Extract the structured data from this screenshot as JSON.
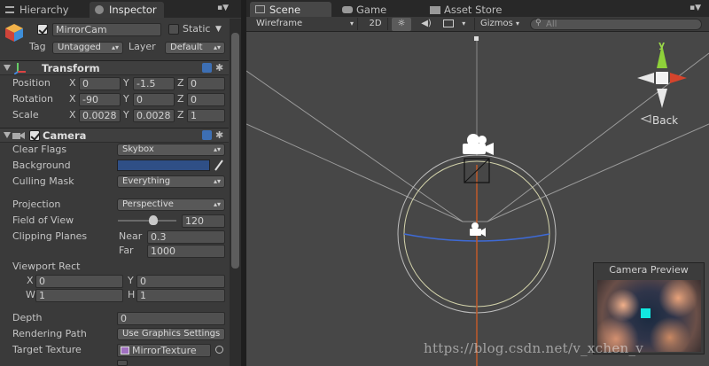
{
  "tabs": {
    "hierarchy": "Hierarchy",
    "inspector": "Inspector",
    "scene": "Scene",
    "game": "Game",
    "asset_store": "Asset Store"
  },
  "object": {
    "name": "MirrorCam",
    "static_label": "Static",
    "tag_label": "Tag",
    "tag_value": "Untagged",
    "layer_label": "Layer",
    "layer_value": "Default",
    "active": true,
    "static": false
  },
  "transform": {
    "title": "Transform",
    "position": {
      "label": "Position",
      "x": "0",
      "y": "-1.5",
      "z": "0"
    },
    "rotation": {
      "label": "Rotation",
      "x": "-90",
      "y": "0",
      "z": "0"
    },
    "scale": {
      "label": "Scale",
      "x": "0.0028",
      "y": "0.0028",
      "z": "1"
    }
  },
  "camera": {
    "title": "Camera",
    "clear_flags": {
      "label": "Clear Flags",
      "value": "Skybox"
    },
    "background": {
      "label": "Background",
      "color": "#2f4f86"
    },
    "culling_mask": {
      "label": "Culling Mask",
      "value": "Everything"
    },
    "projection": {
      "label": "Projection",
      "value": "Perspective"
    },
    "fov": {
      "label": "Field of View",
      "value": "120",
      "slider_fraction": 0.6
    },
    "clipping": {
      "label": "Clipping Planes",
      "near_label": "Near",
      "near": "0.3",
      "far_label": "Far",
      "far": "1000"
    },
    "viewport": {
      "label": "Viewport Rect",
      "x": "0",
      "y": "0",
      "w": "1",
      "h": "1"
    },
    "depth": {
      "label": "Depth",
      "value": "0"
    },
    "rendering_path": {
      "label": "Rendering Path",
      "value": "Use Graphics Settings"
    },
    "target_texture": {
      "label": "Target Texture",
      "value": "MirrorTexture"
    }
  },
  "axis": {
    "x": "X",
    "y": "Y",
    "z": "Z",
    "w": "W",
    "h": "H"
  },
  "scene_toolbar": {
    "shading": "Wireframe",
    "mode_2d": "2D",
    "gizmos": "Gizmos",
    "search_placeholder": "All"
  },
  "gizmo": {
    "back_label": "Back",
    "y_label": "y"
  },
  "preview": {
    "title": "Camera Preview"
  },
  "watermark": "https://blog.csdn.net/v_xchen_v",
  "colors": {
    "accent": "#3d6fb4",
    "selected_tab": "#3b3b3b"
  }
}
